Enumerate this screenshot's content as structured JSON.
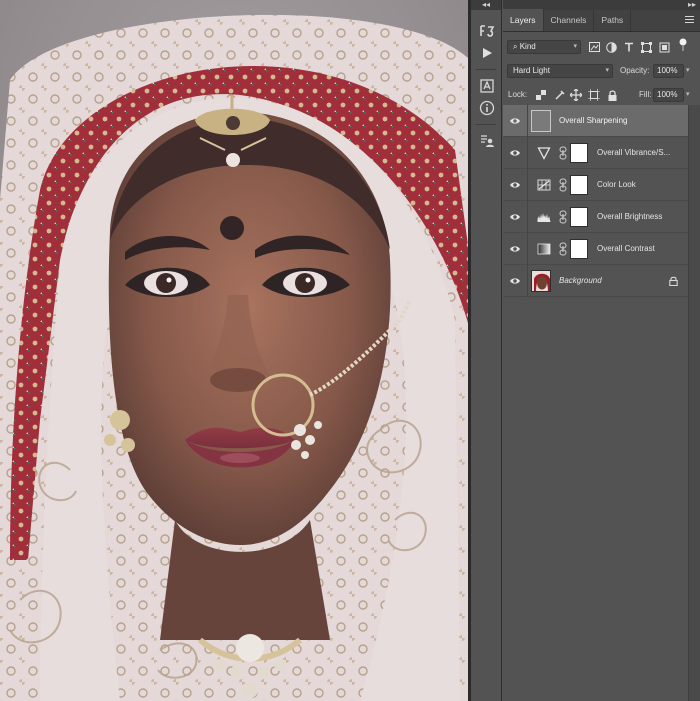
{
  "toolstrip": {
    "collapse_glyph": "◂◂",
    "tools": [
      {
        "icon": "history-brush-icon"
      },
      {
        "icon": "play-action-icon"
      },
      {
        "icon": "character-icon"
      },
      {
        "icon": "info-icon"
      },
      {
        "icon": "properties-icon"
      }
    ]
  },
  "panel": {
    "collapse_glyph": "▸▸",
    "tabs": [
      {
        "label": "Layers",
        "active": true
      },
      {
        "label": "Channels",
        "active": false
      },
      {
        "label": "Paths",
        "active": false
      }
    ],
    "filter": {
      "kind_label": "Kind"
    },
    "blend_mode": "Hard Light",
    "opacity_label": "Opacity:",
    "opacity_value": "100%",
    "lock_label": "Lock:",
    "fill_label": "Fill:",
    "fill_value": "100%"
  },
  "layers": [
    {
      "name": "Overall Sharpening",
      "type": "pixel-gray",
      "selected": true
    },
    {
      "name": "Overall Vibrance/S...",
      "type": "adjustment",
      "icon": "vibrance-icon",
      "selected": false
    },
    {
      "name": "Color Look",
      "type": "adjustment",
      "icon": "color-lookup-icon",
      "selected": false
    },
    {
      "name": "Overall Brightness",
      "type": "adjustment",
      "icon": "levels-icon",
      "selected": false
    },
    {
      "name": "Overall Contrast",
      "type": "adjustment",
      "icon": "gradient-map-icon",
      "selected": false
    },
    {
      "name": "Background",
      "type": "background",
      "locked": true,
      "selected": false
    }
  ],
  "colors": {
    "panel_bg": "#535353",
    "selected_layer": "#6b6b6b",
    "tab_bar": "#424242",
    "veil_red": "#9b1d2a",
    "veil_white": "#ece3e1",
    "skin": "#7a4a36"
  }
}
